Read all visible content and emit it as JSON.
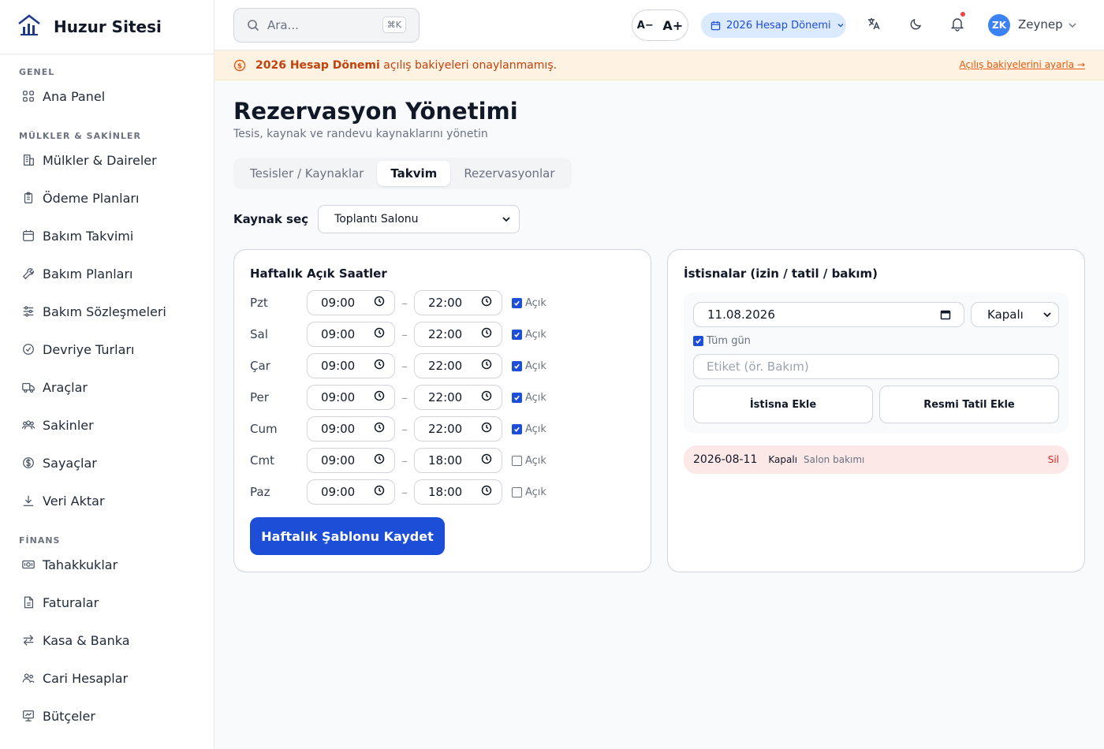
{
  "app": {
    "name": "Huzur Sitesi"
  },
  "sidebar": {
    "sections": [
      {
        "title": "GENEL",
        "items": [
          {
            "label": "Ana Panel",
            "icon": "grid-icon"
          }
        ]
      },
      {
        "title": "MÜLKLER & SAKİNLER",
        "items": [
          {
            "label": "Mülkler & Daireler",
            "icon": "building-icon"
          },
          {
            "label": "Ödeme Planları",
            "icon": "clipboard-icon"
          },
          {
            "label": "Bakım Takvimi",
            "icon": "calendar-icon"
          },
          {
            "label": "Bakım Planları",
            "icon": "wrench-icon"
          },
          {
            "label": "Bakım Sözleşmeleri",
            "icon": "sliders-icon"
          },
          {
            "label": "Devriye Turları",
            "icon": "check-circle-icon"
          },
          {
            "label": "Araçlar",
            "icon": "truck-icon"
          },
          {
            "label": "Sakinler",
            "icon": "users-icon"
          },
          {
            "label": "Sayaçlar",
            "icon": "dollar-icon"
          },
          {
            "label": "Veri Aktar",
            "icon": "download-icon"
          }
        ]
      },
      {
        "title": "FİNANS",
        "items": [
          {
            "label": "Tahakkuklar",
            "icon": "cash-icon"
          },
          {
            "label": "Faturalar",
            "icon": "document-icon"
          },
          {
            "label": "Kasa & Banka",
            "icon": "transfer-icon"
          },
          {
            "label": "Cari Hesaplar",
            "icon": "people-icon"
          },
          {
            "label": "Bütçeler",
            "icon": "presentation-icon"
          }
        ]
      }
    ]
  },
  "topbar": {
    "search_placeholder": "Ara...",
    "search_shortcut": "⌘K",
    "font_decrease": "A−",
    "font_increase": "A+",
    "period": "2026 Hesap Dönemi",
    "user_initials": "ZK",
    "user_name": "Zeynep"
  },
  "banner": {
    "strong": "2026 Hesap Dönemi",
    "text": " açılış bakiyeleri onaylanmamış.",
    "link": "Açılış bakiyelerini ayarla →"
  },
  "page": {
    "title": "Rezervasyon Yönetimi",
    "subtitle": "Tesis, kaynak ve randevu kaynaklarını yönetin",
    "tabs": [
      "Tesisler / Kaynaklar",
      "Takvim",
      "Rezervasyonlar"
    ],
    "active_tab": 1,
    "resource_label": "Kaynak seç",
    "resource_value": "Toplantı Salonu"
  },
  "weekly": {
    "title": "Haftalık Açık Saatler",
    "open_label": "Açık",
    "days": [
      {
        "day": "Pzt",
        "start": "09:00",
        "end": "22:00",
        "open": true
      },
      {
        "day": "Sal",
        "start": "09:00",
        "end": "22:00",
        "open": true
      },
      {
        "day": "Çar",
        "start": "09:00",
        "end": "22:00",
        "open": true
      },
      {
        "day": "Per",
        "start": "09:00",
        "end": "22:00",
        "open": true
      },
      {
        "day": "Cum",
        "start": "09:00",
        "end": "22:00",
        "open": true
      },
      {
        "day": "Cmt",
        "start": "09:00",
        "end": "18:00",
        "open": false
      },
      {
        "day": "Paz",
        "start": "09:00",
        "end": "18:00",
        "open": false
      }
    ],
    "save_label": "Haftalık Şablonu Kaydet"
  },
  "exceptions": {
    "title": "İstisnalar (izin / tatil / bakım)",
    "date_value": "11.08.2026",
    "status_value": "Kapalı",
    "all_day_label": "Tüm gün",
    "all_day": true,
    "label_placeholder": "Etiket (ör. Bakım)",
    "add_label": "İstisna Ekle",
    "holiday_label": "Resmi Tatil Ekle",
    "items": [
      {
        "date": "2026-08-11",
        "status": "Kapalı",
        "label": "Salon bakımı",
        "delete": "Sil"
      }
    ]
  }
}
